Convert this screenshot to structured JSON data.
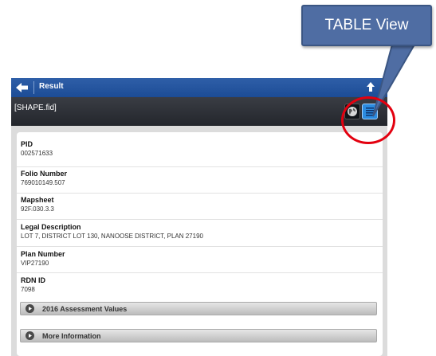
{
  "callout": {
    "label": "TABLE View"
  },
  "header": {
    "title": "Result"
  },
  "subheader": {
    "title": "[SHAPE.fid]"
  },
  "fields": [
    {
      "label": "PID",
      "value": "002571633"
    },
    {
      "label": "Folio Number",
      "value": "769010149.507"
    },
    {
      "label": "Mapsheet",
      "value": "92F.030.3.3"
    },
    {
      "label": "Legal Description",
      "value": "LOT 7, DISTRICT LOT 130, NANOOSE DISTRICT, PLAN 27190"
    },
    {
      "label": "Plan Number",
      "value": "VIP27190"
    },
    {
      "label": "RDN ID",
      "value": "7098"
    }
  ],
  "sections": [
    {
      "label": "2016 Assessment Values"
    },
    {
      "label": "More Information"
    }
  ],
  "colors": {
    "header_blue": "#1c4c96",
    "subheader_dark": "#23262c",
    "callout_blue": "#4f6da3",
    "highlight_red": "#e3000f",
    "table_button": "#2b8be0"
  }
}
